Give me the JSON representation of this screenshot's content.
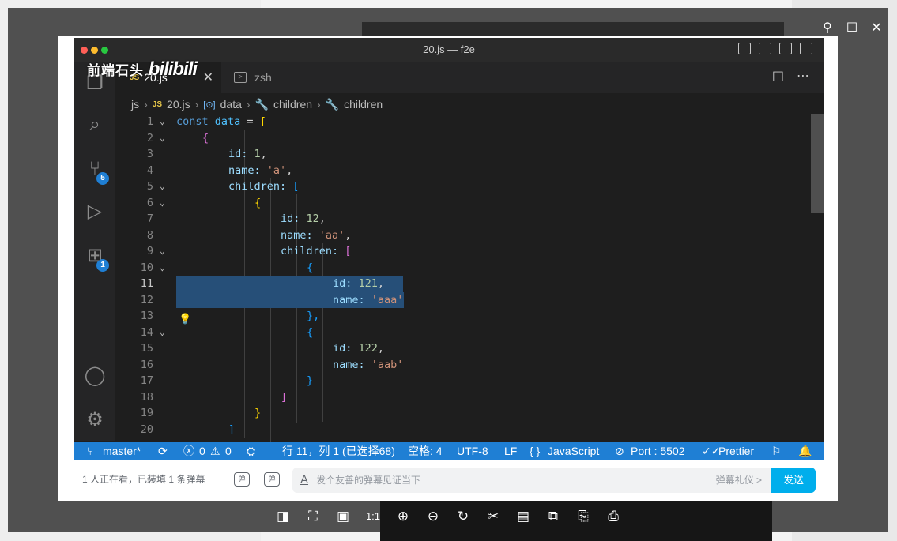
{
  "window": {
    "title": "20.js — f2e"
  },
  "watermark": {
    "text": "前端石头",
    "logo": "bilibili"
  },
  "tabs": [
    {
      "label": "20.js",
      "lang": "JS"
    },
    {
      "label": "zsh"
    }
  ],
  "breadcrumb": [
    "js",
    "20.js",
    "data",
    "children",
    "children"
  ],
  "badges": {
    "scm": "5",
    "extensions": "1"
  },
  "code_lines": [
    {
      "n": "1",
      "fold": true
    },
    {
      "n": "2",
      "fold": true
    },
    {
      "n": "3"
    },
    {
      "n": "4"
    },
    {
      "n": "5",
      "fold": true
    },
    {
      "n": "6",
      "fold": true
    },
    {
      "n": "7"
    },
    {
      "n": "8"
    },
    {
      "n": "9",
      "fold": true
    },
    {
      "n": "10",
      "fold": true
    },
    {
      "n": "11"
    },
    {
      "n": "12"
    },
    {
      "n": "13"
    },
    {
      "n": "14",
      "fold": true
    },
    {
      "n": "15"
    },
    {
      "n": "16"
    },
    {
      "n": "17"
    },
    {
      "n": "18"
    },
    {
      "n": "19"
    },
    {
      "n": "20"
    }
  ],
  "code_tokens": {
    "const": "const",
    "data": "data",
    "eq": " = ",
    "lbr": "[",
    "rbr": "]",
    "lcb": "{",
    "rcb": "}",
    "rcbc": "},",
    "rcbcomma": "},",
    "id_key": "id:",
    "name_key": "name:",
    "children_key": "children:",
    "v1": "1",
    "va": "'a'",
    "v12": "12",
    "vaa": "'aa'",
    "v121": "121",
    "vaaa": "'aaa'",
    "v122": "122",
    "vaab": "'aab'",
    "comma": ","
  },
  "statusbar": {
    "branch": "master*",
    "errors": "0",
    "warnings": "0",
    "position": "行 11，列 1 (已选择68)",
    "spaces": "空格: 4",
    "encoding": "UTF-8",
    "eol": "LF",
    "language": "JavaScript",
    "port": "Port : 5502",
    "formatter": "Prettier"
  },
  "danmaku": {
    "viewers": "1 人正在看，已装填 1 条弹幕",
    "placeholder": "发个友善的弹幕见证当下",
    "etiquette": "弹幕礼仪 >",
    "send": "发送",
    "icon1": "弹",
    "icon2": "弹"
  },
  "viewer": {
    "ratio": "1:1"
  },
  "colors": {
    "accent": "#1f7fd4",
    "send": "#00aeec",
    "editor_bg": "#1e1e1e"
  }
}
